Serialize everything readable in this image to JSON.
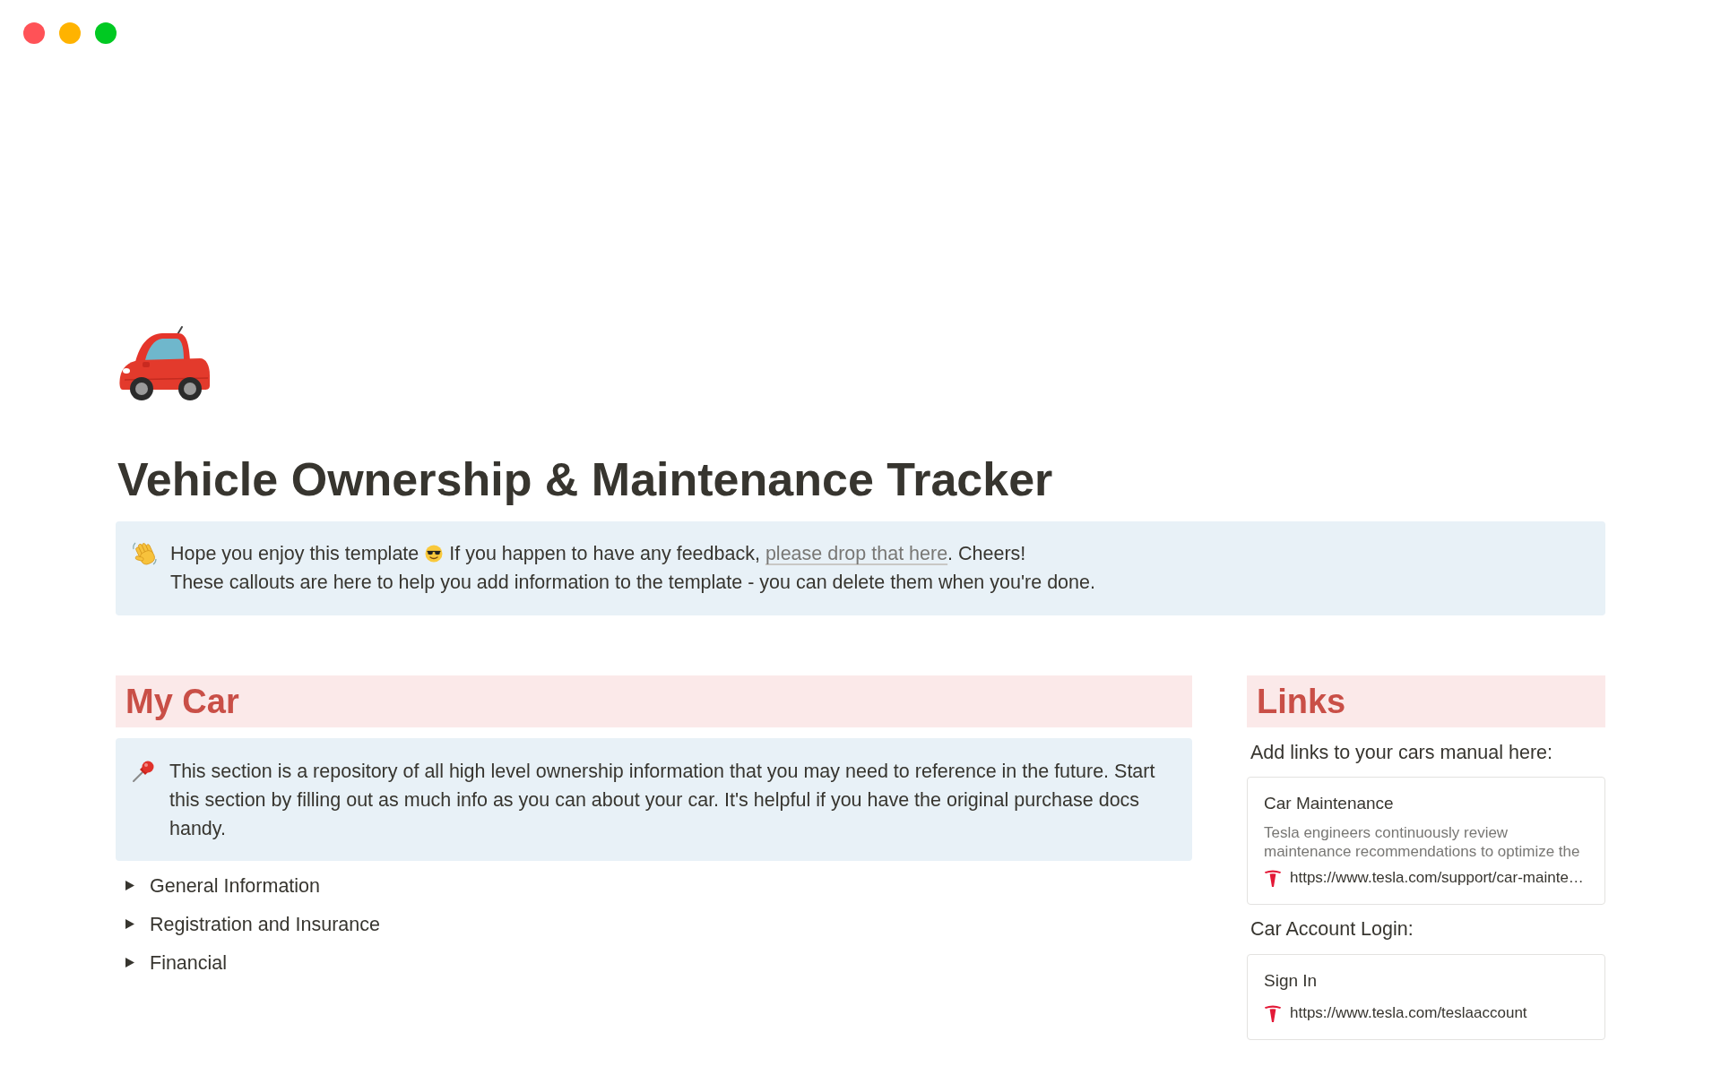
{
  "window": {
    "controls": [
      {
        "color": "#ff5257"
      },
      {
        "color": "#ffb300"
      },
      {
        "color": "#00c922"
      }
    ]
  },
  "page": {
    "title": "Vehicle Ownership & Maintenance Tracker"
  },
  "intro_callout": {
    "line_1_start": "Hope you enjoy this template",
    "line_1_feedback": "If you happen to have any feedback, ",
    "link": "please drop that here",
    "line_1_end": ". Cheers!",
    "line_2": "These callouts are here to help you add information to the template - you can delete them when you're done."
  },
  "my_car": {
    "heading": "My Car",
    "callout": {
      "text": "This section is a repository of all high level ownership information that you may need to reference in the future. Start this section by filling out as much info as you can about your car. It's helpful if you have the original purchase docs handy."
    },
    "toggles": [
      {
        "label": "General Information",
        "expanded": false
      },
      {
        "label": "Registration and Insurance",
        "expanded": false
      },
      {
        "label": "Financial",
        "expanded": false
      }
    ]
  },
  "links": {
    "heading": "Links",
    "sections": [
      {
        "label": "Add links to your cars manual here:",
        "bookmark": {
          "title": "Car Maintenance",
          "description": "Tesla engineers continuously review\nmaintenance recommendations to optimize the",
          "url": "https://www.tesla.com/support/car-mainte…"
        }
      },
      {
        "label": "Car Account Login:",
        "bookmark": {
          "title": "Sign In",
          "url": "https://www.tesla.com/teslaaccount"
        }
      }
    ]
  }
}
